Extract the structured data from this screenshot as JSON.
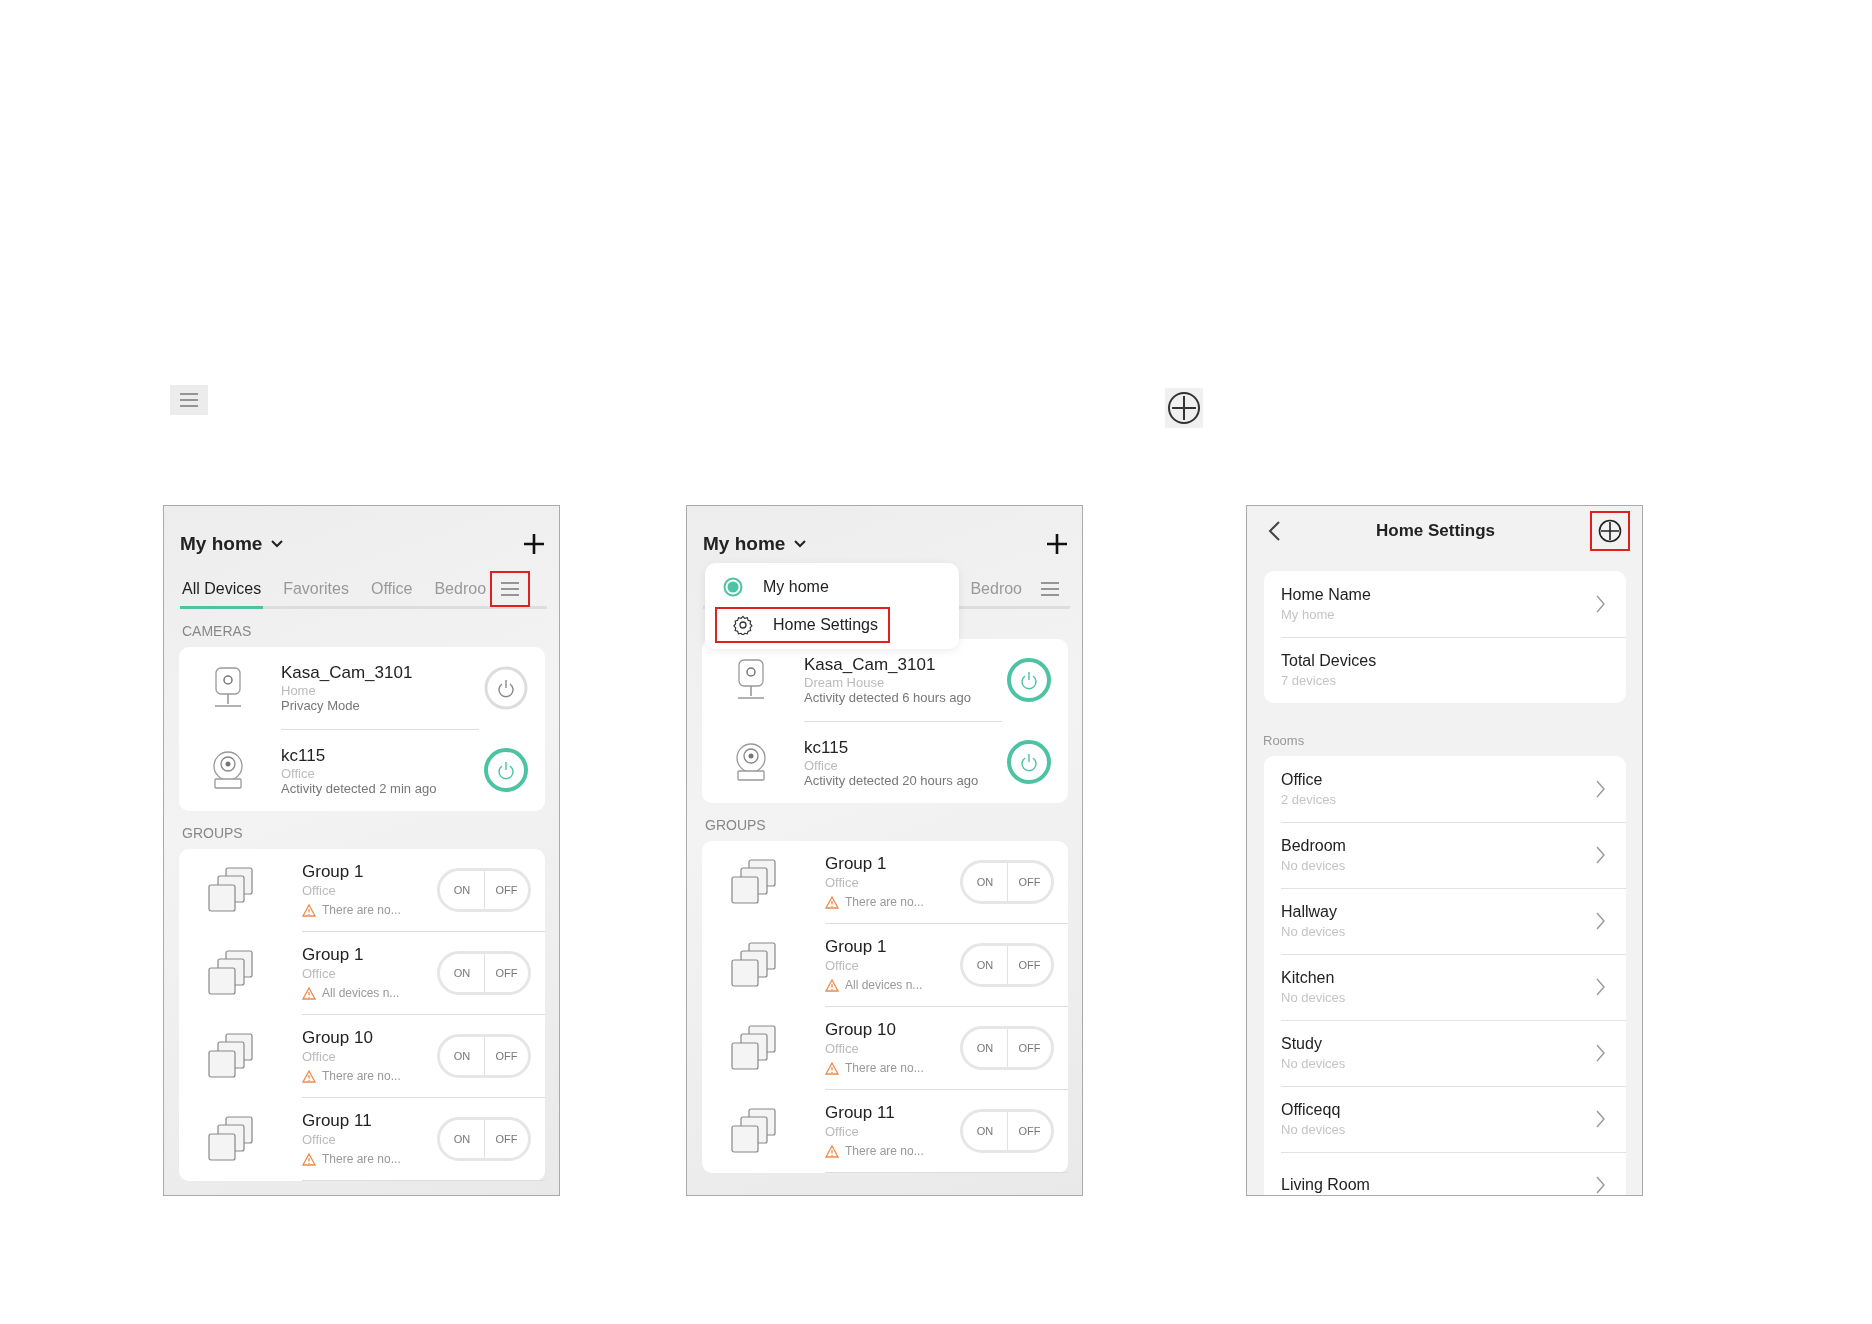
{
  "screens": [
    {
      "kind": "devices",
      "home_title": "My home",
      "menu_highlighted": true,
      "tabs": [
        {
          "label": "All Devices",
          "selected": true
        },
        {
          "label": "Favorites",
          "selected": false
        },
        {
          "label": "Office",
          "selected": false
        },
        {
          "label": "Bedroo",
          "selected": false
        }
      ],
      "cameras_label": "CAMERAS",
      "cameras": [
        {
          "kind": "indoor",
          "name": "Kasa_Cam_3101",
          "room": "Home",
          "status": "Privacy Mode",
          "on": false
        },
        {
          "kind": "pan-tilt",
          "name": "kc115",
          "room": "Office",
          "status": "Activity detected 2 min ago",
          "on": true
        }
      ],
      "groups_label": "GROUPS",
      "groups": [
        {
          "name": "Group 1",
          "room": "Office",
          "warning": "There are no...",
          "on_label": "ON",
          "off_label": "OFF",
          "on_selected": false,
          "off_selected": false
        },
        {
          "name": "Group 1",
          "room": "Office",
          "warning": "All devices n...",
          "on_label": "ON",
          "off_label": "OFF",
          "on_selected": false,
          "off_selected": false
        },
        {
          "name": "Group 10",
          "room": "Office",
          "warning": "There are no...",
          "on_label": "ON",
          "off_label": "OFF",
          "on_selected": false,
          "off_selected": false
        },
        {
          "name": "Group 11",
          "room": "Office",
          "warning": "There are no...",
          "on_label": "ON",
          "off_label": "OFF",
          "on_selected": false,
          "off_selected": false
        }
      ]
    },
    {
      "kind": "devices",
      "home_title": "My home",
      "menu_highlighted": false,
      "tabs": [
        {
          "label": "Bedroo",
          "selected": false
        }
      ],
      "dropdown": [
        {
          "kind": "home",
          "label": "My home",
          "selected": true,
          "highlighted": false
        },
        {
          "kind": "settings",
          "label": "Home Settings",
          "highlighted": true
        }
      ],
      "cameras": [
        {
          "kind": "indoor",
          "name": "Kasa_Cam_3101",
          "room": "Dream House",
          "status": "Activity detected 6 hours ago",
          "on": true
        },
        {
          "kind": "pan-tilt",
          "name": "kc115",
          "room": "Office",
          "status": "Activity detected 20 hours ago",
          "on": true
        }
      ],
      "groups_label": "GROUPS",
      "groups": [
        {
          "name": "Group 1",
          "room": "Office",
          "warning": "There are no...",
          "on_label": "ON",
          "off_label": "OFF",
          "on_selected": false,
          "off_selected": false
        },
        {
          "name": "Group 1",
          "room": "Office",
          "warning": "All devices n...",
          "on_label": "ON",
          "off_label": "OFF",
          "on_selected": false,
          "off_selected": false
        },
        {
          "name": "Group 10",
          "room": "Office",
          "warning": "There are no...",
          "on_label": "ON",
          "off_label": "OFF",
          "on_selected": false,
          "off_selected": false
        },
        {
          "name": "Group 11",
          "room": "Office",
          "warning": "There are no...",
          "on_label": "ON",
          "off_label": "OFF",
          "on_selected": false,
          "off_selected": false
        }
      ]
    },
    {
      "kind": "settings",
      "title": "Home Settings",
      "add_highlighted": true,
      "sections": [
        {
          "items": [
            {
              "title": "Home Name",
              "subtitle": "My home",
              "chevron": true
            },
            {
              "title": "Total Devices",
              "subtitle": "7 devices",
              "chevron": false
            }
          ]
        },
        {
          "label": "Rooms",
          "items": [
            {
              "title": "Office",
              "subtitle": "2 devices",
              "chevron": true
            },
            {
              "title": "Bedroom",
              "subtitle": "No devices",
              "chevron": true
            },
            {
              "title": "Hallway",
              "subtitle": "No devices",
              "chevron": true
            },
            {
              "title": "Kitchen",
              "subtitle": "No devices",
              "chevron": true
            },
            {
              "title": "Study",
              "subtitle": "No devices",
              "chevron": true
            },
            {
              "title": "Officeqq",
              "subtitle": "No devices",
              "chevron": true
            },
            {
              "title": "Living Room",
              "chevron": true
            }
          ]
        }
      ]
    }
  ]
}
